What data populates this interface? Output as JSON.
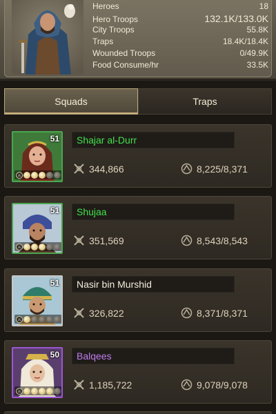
{
  "stats": {
    "rows": [
      {
        "label": "Heroes",
        "value": "18"
      },
      {
        "label": "Hero Troops",
        "value": "132.1K/133.0K"
      },
      {
        "label": "City Troops",
        "value": "55.8K"
      },
      {
        "label": "Traps",
        "value": "18.4K/18.4K"
      },
      {
        "label": "Wounded Troops",
        "value": "0/49.9K"
      },
      {
        "label": "Food Consume/hr",
        "value": "33.5K"
      }
    ]
  },
  "tabs": [
    {
      "label": "Squads",
      "active": true
    },
    {
      "label": "Traps",
      "active": false
    }
  ],
  "colors": {
    "name_green": "#43e04a",
    "name_white": "#f2ecdc",
    "name_purple": "#c07cf0",
    "frame_green": "#4aa64f",
    "frame_white": "#c8c8c8",
    "frame_purple": "#9c55d4"
  },
  "squads": [
    {
      "name": "Shajar al-Durr",
      "level": "51",
      "power": "344,866",
      "troops": "8,225/8,371",
      "rarity": "green",
      "stars_filled": 3
    },
    {
      "name": "Shujaa",
      "level": "51",
      "power": "351,569",
      "troops": "8,543/8,543",
      "rarity": "green",
      "stars_filled": 3
    },
    {
      "name": "Nasir bin Murshid",
      "level": "51",
      "power": "326,822",
      "troops": "8,371/8,371",
      "rarity": "white",
      "stars_filled": 1
    },
    {
      "name": "Balqees",
      "level": "50",
      "power": "1,185,722",
      "troops": "9,078/9,078",
      "rarity": "purple",
      "stars_filled": 4
    }
  ],
  "icons": {
    "power": "crossed-swords-icon",
    "troops": "helmet-icon"
  }
}
